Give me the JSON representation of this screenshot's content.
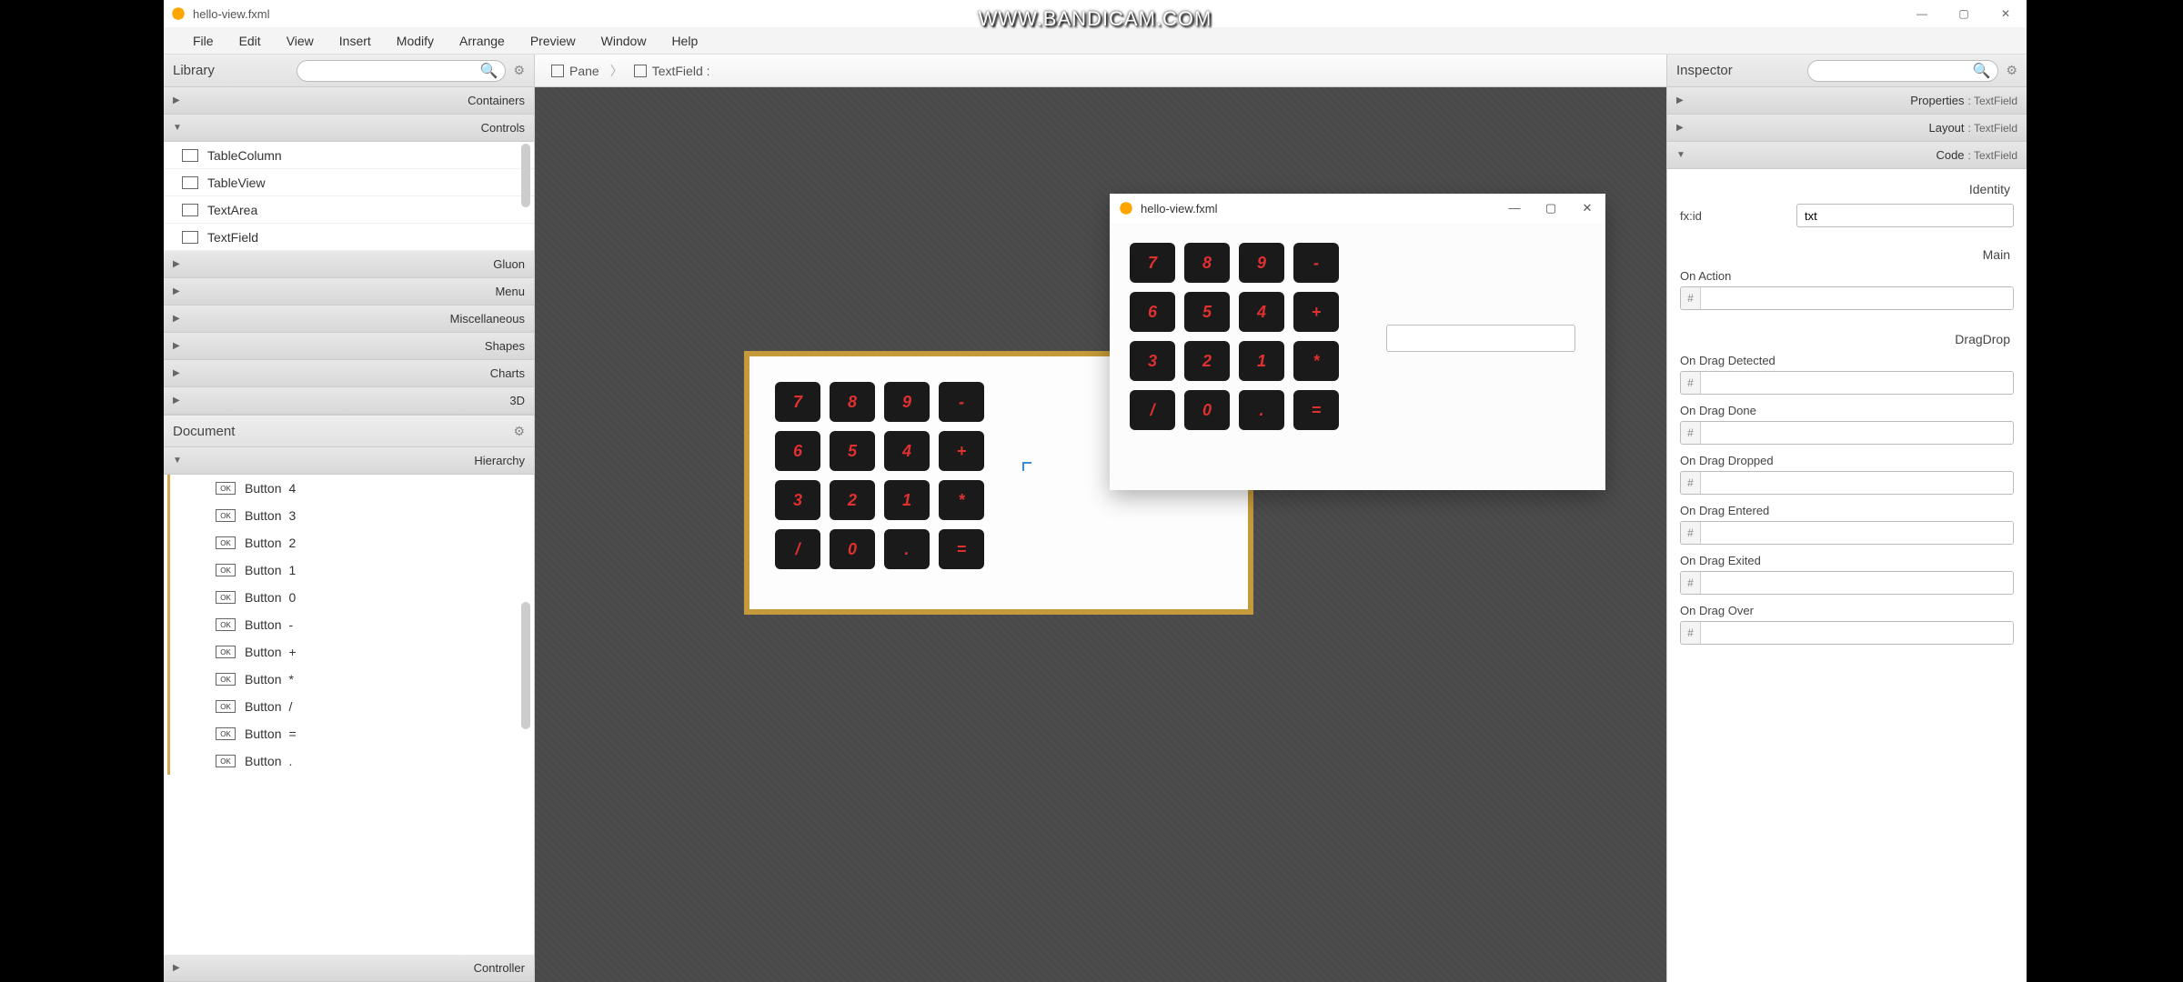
{
  "watermark": "WWW.BANDICAM.COM",
  "titlebar": {
    "title": "hello-view.fxml"
  },
  "window_controls": {
    "min": "—",
    "max": "▢",
    "close": "✕"
  },
  "menubar": [
    "File",
    "Edit",
    "View",
    "Insert",
    "Modify",
    "Arrange",
    "Preview",
    "Window",
    "Help"
  ],
  "library": {
    "title": "Library",
    "sections": {
      "containers": "Containers",
      "controls": "Controls",
      "gluon": "Gluon",
      "menu": "Menu",
      "misc": "Miscellaneous",
      "shapes": "Shapes",
      "charts": "Charts",
      "threed": "3D"
    },
    "controls_items": [
      "TableColumn",
      "TableView",
      "TextArea",
      "TextField"
    ]
  },
  "document": {
    "title": "Document",
    "hierarchy": "Hierarchy",
    "controller": "Controller",
    "items": [
      {
        "type": "Button",
        "text": "4"
      },
      {
        "type": "Button",
        "text": "3"
      },
      {
        "type": "Button",
        "text": "2"
      },
      {
        "type": "Button",
        "text": "1"
      },
      {
        "type": "Button",
        "text": "0"
      },
      {
        "type": "Button",
        "text": "-"
      },
      {
        "type": "Button",
        "text": "+"
      },
      {
        "type": "Button",
        "text": "*"
      },
      {
        "type": "Button",
        "text": "/"
      },
      {
        "type": "Button",
        "text": "="
      },
      {
        "type": "Button",
        "text": "."
      }
    ]
  },
  "breadcrumb": {
    "pane": "Pane",
    "field": "TextField :"
  },
  "calc_buttons": [
    "7",
    "8",
    "9",
    "-",
    "6",
    "5",
    "4",
    "+",
    "3",
    "2",
    "1",
    "*",
    "/",
    "0",
    ".",
    "="
  ],
  "runtime": {
    "title": "hello-view.fxml",
    "buttons": [
      "7",
      "8",
      "9",
      "-",
      "6",
      "5",
      "4",
      "+",
      "3",
      "2",
      "1",
      "*",
      "/",
      "0",
      ".",
      "="
    ]
  },
  "inspector": {
    "title": "Inspector",
    "sections": {
      "properties": "Properties",
      "properties_sub": ": TextField",
      "layout": "Layout",
      "layout_sub": ": TextField",
      "code": "Code",
      "code_sub": ": TextField"
    },
    "identity": "Identity",
    "fxid_label": "fx:id",
    "fxid_value": "txt",
    "main": "Main",
    "on_action": "On Action",
    "dragdrop": "DragDrop",
    "events": [
      "On Drag Detected",
      "On Drag Done",
      "On Drag Dropped",
      "On Drag Entered",
      "On Drag Exited",
      "On Drag Over"
    ]
  }
}
